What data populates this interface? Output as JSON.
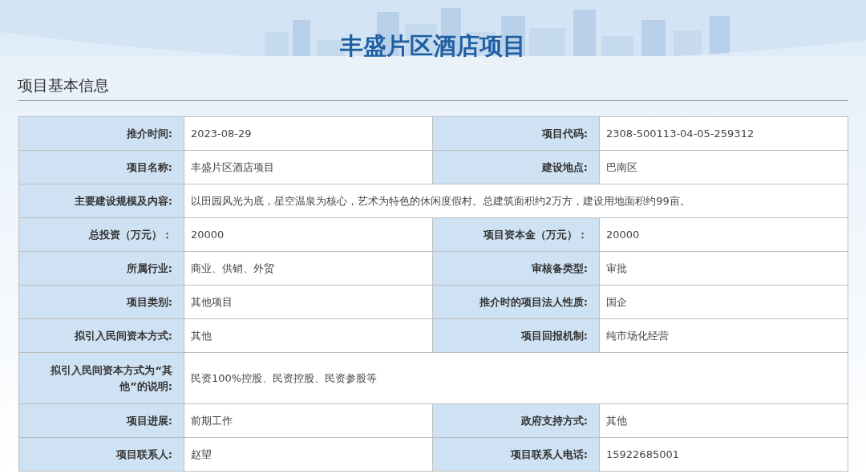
{
  "title": "丰盛片区酒店项目",
  "section": {
    "heading": "项目基本信息"
  },
  "rows": [
    {
      "kind": "pair",
      "cells": [
        {
          "label": "推介时间:",
          "value": "2023-08-29"
        },
        {
          "label": "项目代码:",
          "value": "2308-500113-04-05-259312"
        }
      ]
    },
    {
      "kind": "pair",
      "cells": [
        {
          "label": "项目名称:",
          "value": "丰盛片区酒店项目"
        },
        {
          "label": "建设地点:",
          "value": "巴南区"
        }
      ]
    },
    {
      "kind": "wide",
      "cells": [
        {
          "label": "主要建设规模及内容:",
          "value": "以田园风光为底，星空温泉为核心，艺术为特色的休闲度假村。总建筑面积约2万方，建设用地面积约99亩。"
        }
      ]
    },
    {
      "kind": "pair",
      "cells": [
        {
          "label": "总投资（万元）：",
          "value": "20000"
        },
        {
          "label": "项目资本金（万元）：",
          "value": "20000"
        }
      ]
    },
    {
      "kind": "pair",
      "cells": [
        {
          "label": "所属行业:",
          "value": "商业、供销、外贸"
        },
        {
          "label": "审核备类型:",
          "value": "审批"
        }
      ]
    },
    {
      "kind": "pair",
      "cells": [
        {
          "label": "项目类别:",
          "value": "其他项目"
        },
        {
          "label": "推介时的项目法人性质:",
          "value": "国企"
        }
      ]
    },
    {
      "kind": "pair",
      "cells": [
        {
          "label": "拟引入民间资本方式:",
          "value": "其他"
        },
        {
          "label": "项目回报机制:",
          "value": "纯市场化经营"
        }
      ]
    },
    {
      "kind": "wide",
      "cells": [
        {
          "label": "拟引入民间资本方式为“其他”的说明:",
          "value": "民资100%控股、民资控股、民资参股等"
        }
      ]
    },
    {
      "kind": "pair",
      "cells": [
        {
          "label": "项目进展:",
          "value": "前期工作"
        },
        {
          "label": "政府支持方式:",
          "value": "其他"
        }
      ]
    },
    {
      "kind": "pair",
      "cells": [
        {
          "label": "项目联系人:",
          "value": "赵望"
        },
        {
          "label": "项目联系人电话:",
          "value": "15922685001"
        }
      ]
    }
  ]
}
